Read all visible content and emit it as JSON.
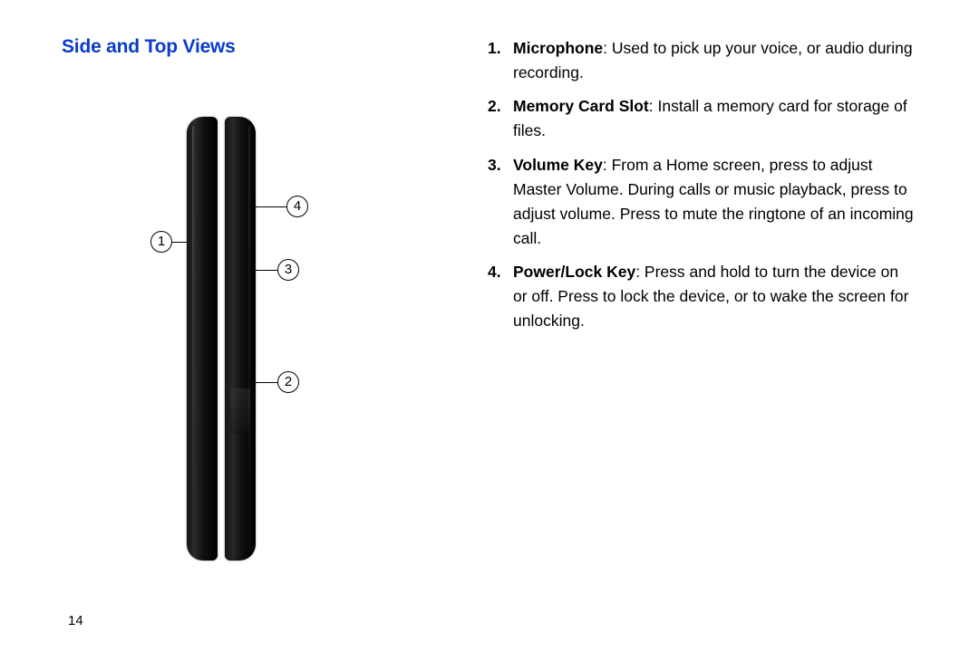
{
  "heading": "Side and Top Views",
  "callouts": {
    "c1": "1",
    "c2": "2",
    "c3": "3",
    "c4": "4"
  },
  "items": [
    {
      "term": "Microphone",
      "desc": ": Used to pick up your voice, or audio during recording."
    },
    {
      "term": "Memory Card Slot",
      "desc": ": Install a memory card for storage of files."
    },
    {
      "term": "Volume Key",
      "desc": ": From a Home screen, press to adjust Master Volume. During calls or music playback, press to adjust volume. Press to mute the ringtone of an incoming call."
    },
    {
      "term": "Power/Lock Key",
      "desc": ": Press and hold to turn the device on or off. Press to lock the device, or to wake the screen for unlocking."
    }
  ],
  "page_number": "14"
}
